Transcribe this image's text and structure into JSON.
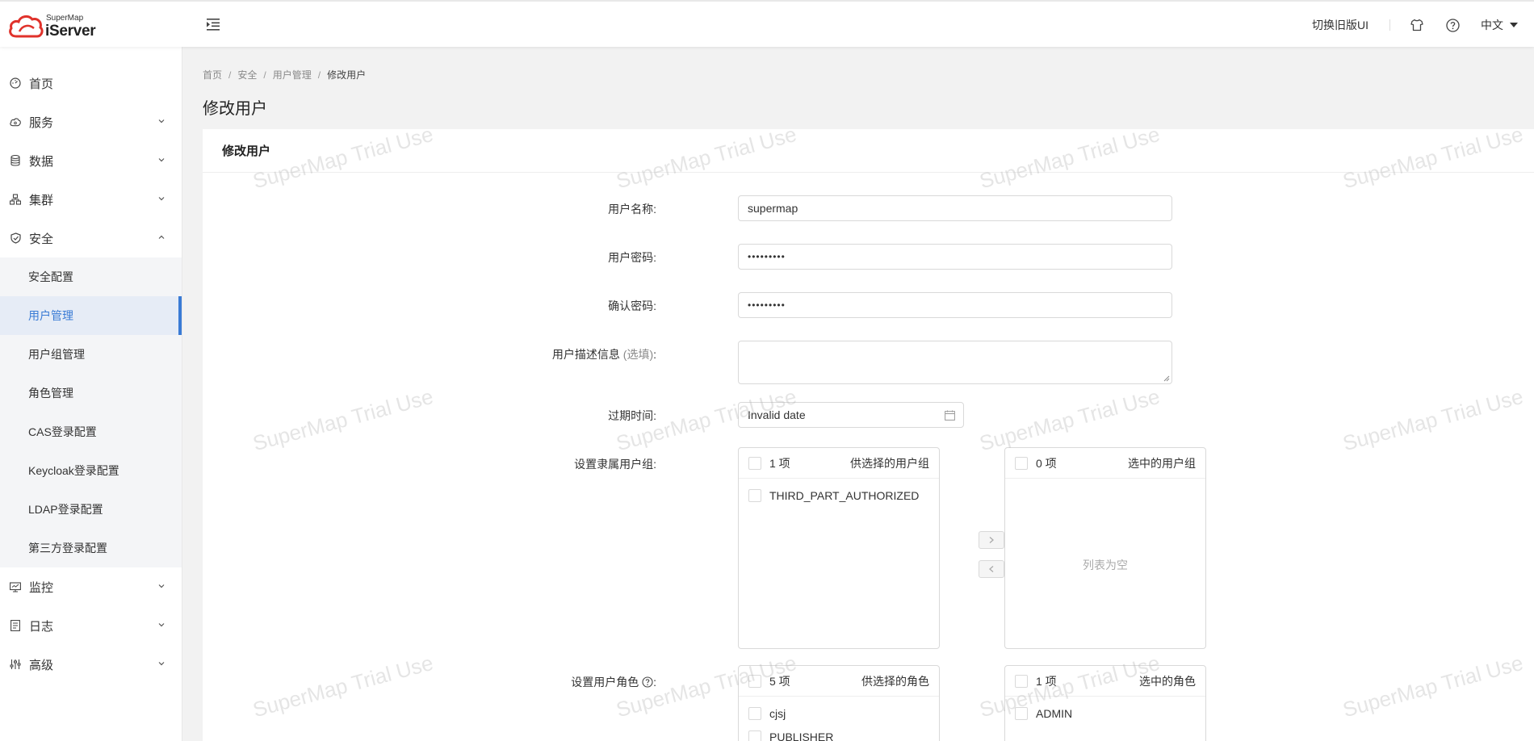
{
  "header": {
    "brand_small": "SuperMap",
    "brand_big": "iServer",
    "switch_ui": "切换旧版UI",
    "language": "中文"
  },
  "sidebar": {
    "items": [
      {
        "label": "首页",
        "icon": "home-icon"
      },
      {
        "label": "服务",
        "icon": "cloud-icon"
      },
      {
        "label": "数据",
        "icon": "database-icon"
      },
      {
        "label": "集群",
        "icon": "cluster-icon"
      },
      {
        "label": "安全",
        "icon": "shield-icon",
        "expanded": true
      },
      {
        "label": "监控",
        "icon": "monitor-icon"
      },
      {
        "label": "日志",
        "icon": "log-icon"
      },
      {
        "label": "高级",
        "icon": "sliders-icon"
      }
    ],
    "security_sub": [
      {
        "label": "安全配置"
      },
      {
        "label": "用户管理",
        "active": true
      },
      {
        "label": "用户组管理"
      },
      {
        "label": "角色管理"
      },
      {
        "label": "CAS登录配置"
      },
      {
        "label": "Keycloak登录配置"
      },
      {
        "label": "LDAP登录配置"
      },
      {
        "label": "第三方登录配置"
      }
    ]
  },
  "breadcrumb": [
    "首页",
    "安全",
    "用户管理",
    "修改用户"
  ],
  "page_title": "修改用户",
  "card_title": "修改用户",
  "form": {
    "username_label": "用户名称:",
    "username_value": "supermap",
    "password_label": "用户密码:",
    "password_value": "•••••••••",
    "confirm_label": "确认密码:",
    "confirm_value": "•••••••••",
    "desc_label": "用户描述信息",
    "desc_optional": "(选填)",
    "desc_colon": ":",
    "desc_value": "",
    "expire_label": "过期时间:",
    "expire_value": "Invalid date",
    "groups_label": "设置隶属用户组:",
    "roles_label": "设置用户角色",
    "roles_colon": ":"
  },
  "groups_transfer": {
    "left": {
      "count": "1 项",
      "title": "供选择的用户组",
      "items": [
        "THIRD_PART_AUTHORIZED"
      ]
    },
    "right": {
      "count": "0 项",
      "title": "选中的用户组",
      "empty": "列表为空"
    }
  },
  "roles_transfer": {
    "left": {
      "count": "5 项",
      "title": "供选择的角色",
      "items": [
        "cjsj",
        "PUBLISHER"
      ]
    },
    "right": {
      "count": "1 项",
      "title": "选中的角色",
      "items": [
        "ADMIN"
      ]
    }
  },
  "watermark": "SuperMap Trial Use",
  "colors": {
    "accent": "#3a7bd5",
    "logo_red": "#e0322b"
  }
}
